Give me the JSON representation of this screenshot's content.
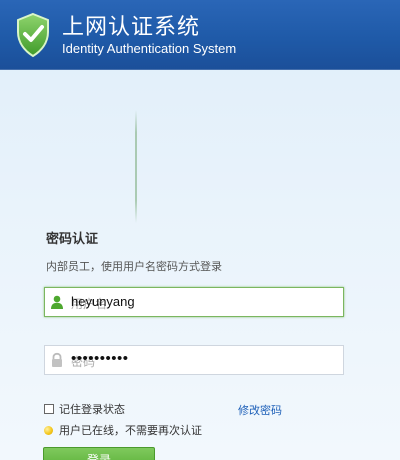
{
  "header": {
    "title": "上网认证系统",
    "subtitle": "Identity Authentication System",
    "logo_icon": "shield-check-icon"
  },
  "login": {
    "title": "密码认证",
    "description": "内部员工，使用用户名密码方式登录",
    "username": {
      "placeholder": "用户名",
      "value": "heyunyang",
      "icon": "user-icon"
    },
    "password": {
      "placeholder": "密码",
      "value": "••••••••••",
      "icon": "lock-icon"
    },
    "remember_label": "记住登录状态",
    "change_password_label": "修改密码",
    "status_text": "用户已在线，不需要再次认证",
    "submit_label": "登录"
  },
  "colors": {
    "header": "#1f5aa8",
    "accent_green": "#56ad33",
    "link": "#1c5fb8"
  }
}
